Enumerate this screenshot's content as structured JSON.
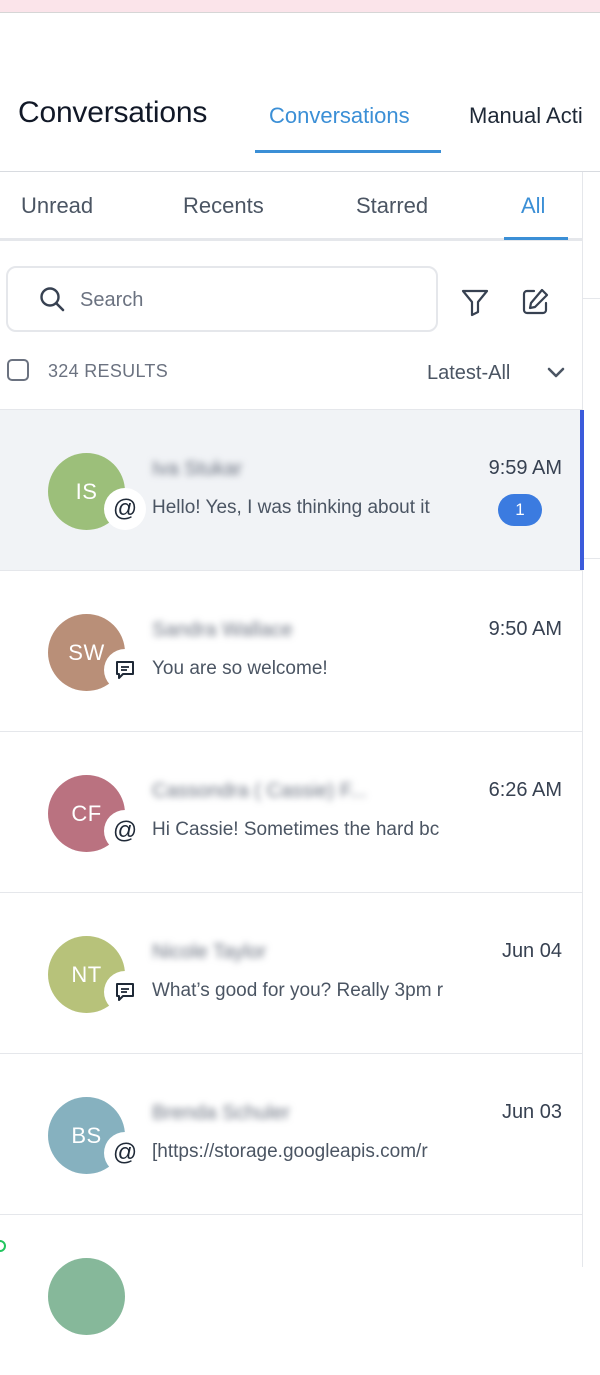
{
  "header": {
    "title": "Conversations",
    "tabs": [
      {
        "label": "Conversations",
        "active": true
      },
      {
        "label": "Manual Acti",
        "active": false
      }
    ]
  },
  "sub_tabs": [
    {
      "label": "Unread",
      "active": false
    },
    {
      "label": "Recents",
      "active": false
    },
    {
      "label": "Starred",
      "active": false
    },
    {
      "label": "All",
      "active": true
    }
  ],
  "search": {
    "placeholder": "Search",
    "value": ""
  },
  "toolbar": {
    "filter_icon": "filter-icon",
    "compose_icon": "compose-icon"
  },
  "results": {
    "count_label": "324 RESULTS",
    "sort_label": "Latest-All"
  },
  "conversations": [
    {
      "initials": "IS",
      "name": "Iva Stukar",
      "preview": "Hello! Yes, I was thinking about it",
      "time": "9:59 AM",
      "unread": "1",
      "channel": "at-sign-icon",
      "avatar_color": "#9cbf7a",
      "selected": true
    },
    {
      "initials": "SW",
      "name": "Sandra Wallace",
      "preview": "You are so welcome!",
      "time": "9:50 AM",
      "channel": "chat-bubble-icon",
      "avatar_color": "#b98f78",
      "selected": false
    },
    {
      "initials": "CF",
      "name": "Cassondra ( Cassie) F...",
      "preview": "Hi Cassie! Sometimes the hard bc",
      "time": "6:26 AM",
      "channel": "at-sign-icon",
      "avatar_color": "#ba7280",
      "selected": false
    },
    {
      "initials": "NT",
      "name": "Nicole Taylor",
      "preview": "What’s good for you? Really 3pm r",
      "time": "Jun 04",
      "channel": "chat-bubble-icon",
      "avatar_color": "#b7c27a",
      "selected": false
    },
    {
      "initials": "BS",
      "name": "Brenda Schuler",
      "preview": "[https://storage.googleapis.com/r",
      "time": "Jun 03",
      "channel": "at-sign-icon",
      "avatar_color": "#86b1bf",
      "selected": false
    }
  ],
  "colors": {
    "accent": "#3b8fd6",
    "selected_bar": "#3b5bdb",
    "badge": "#3b7be0"
  }
}
